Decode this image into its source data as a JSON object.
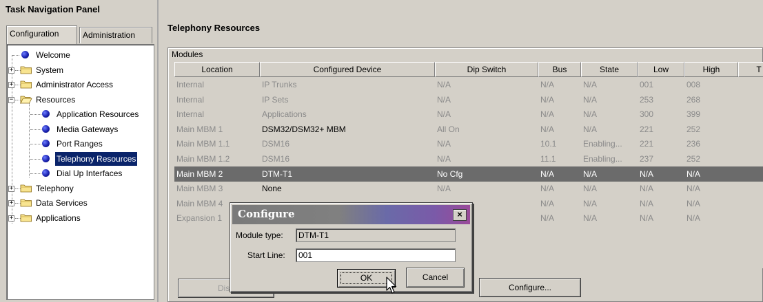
{
  "nav": {
    "title": "Task Navigation Panel",
    "tabs": [
      {
        "label": "Configuration",
        "active": true
      },
      {
        "label": "Administration",
        "active": false
      }
    ],
    "tree": [
      {
        "label": "Welcome",
        "icon": "bullet-icon",
        "level": 0
      },
      {
        "label": "System",
        "icon": "folder-icon",
        "level": 0,
        "expander": "+"
      },
      {
        "label": "Administrator Access",
        "icon": "folder-icon",
        "level": 0,
        "expander": "+"
      },
      {
        "label": "Resources",
        "icon": "folder-open-icon",
        "level": 0,
        "expander": "−"
      },
      {
        "label": "Application Resources",
        "icon": "bullet-icon",
        "level": 1
      },
      {
        "label": "Media Gateways",
        "icon": "bullet-icon",
        "level": 1
      },
      {
        "label": "Port Ranges",
        "icon": "bullet-icon",
        "level": 1
      },
      {
        "label": "Telephony Resources",
        "icon": "bullet-icon",
        "level": 1,
        "selected": true
      },
      {
        "label": "Dial Up Interfaces",
        "icon": "bullet-icon",
        "level": 1
      },
      {
        "label": "Telephony",
        "icon": "folder-icon",
        "level": 0,
        "expander": "+"
      },
      {
        "label": "Data Services",
        "icon": "folder-icon",
        "level": 0,
        "expander": "+"
      },
      {
        "label": "Applications",
        "icon": "folder-icon",
        "level": 0,
        "expander": "+"
      }
    ]
  },
  "main": {
    "title": "Telephony Resources",
    "modules_label": "Modules",
    "columns": [
      "Location",
      "Configured Device",
      "Dip Switch",
      "Bus",
      "State",
      "Low",
      "High",
      "T"
    ],
    "rows": [
      [
        "Internal",
        "IP Trunks",
        "N/A",
        "N/A",
        "N/A",
        "001",
        "008"
      ],
      [
        "Internal",
        "IP Sets",
        "N/A",
        "N/A",
        "N/A",
        "253",
        "268"
      ],
      [
        "Internal",
        "Applications",
        "N/A",
        "N/A",
        "N/A",
        "300",
        "399"
      ],
      [
        "Main MBM  1",
        "DSM32/DSM32+ MBM",
        "All On",
        "N/A",
        "N/A",
        "221",
        "252"
      ],
      [
        "Main MBM  1.1",
        "DSM16",
        "N/A",
        "10.1",
        "Enabling...",
        "221",
        "236"
      ],
      [
        "Main MBM  1.2",
        "DSM16",
        "N/A",
        "11.1",
        "Enabling...",
        "237",
        "252"
      ],
      [
        "Main MBM  2",
        "DTM-T1",
        "No Cfg",
        "N/A",
        "N/A",
        "N/A",
        "N/A"
      ],
      [
        "Main MBM  3",
        "None",
        "N/A",
        "N/A",
        "N/A",
        "N/A",
        "N/A"
      ],
      [
        "Main MBM  4",
        "",
        "",
        "N/A",
        "N/A",
        "N/A",
        "N/A"
      ],
      [
        "Expansion 1",
        "",
        "",
        "N/A",
        "N/A",
        "N/A",
        "N/A"
      ]
    ],
    "selected_row": 6,
    "buttons": {
      "disable": "Disa",
      "configure": "Configure..."
    }
  },
  "dialog": {
    "title": "Configure",
    "close_label": "×",
    "module_type_label": "Module type:",
    "module_type_value": "DTM-T1",
    "start_line_label": "Start Line:",
    "start_line_value": "001",
    "ok_label": "OK",
    "cancel_label": "Cancel"
  }
}
